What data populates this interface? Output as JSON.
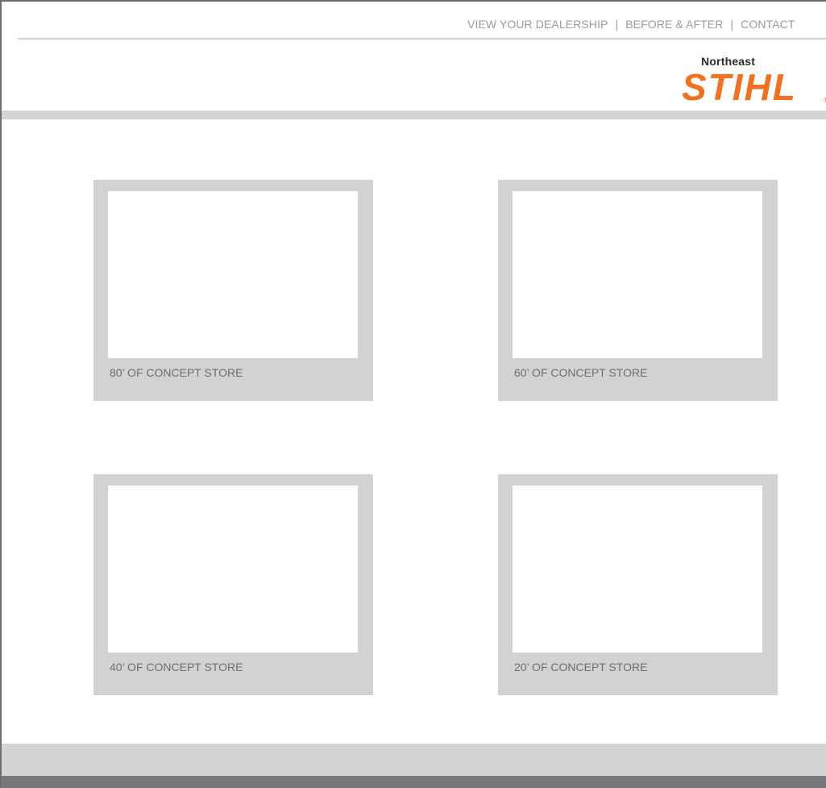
{
  "nav": {
    "items": [
      {
        "label": "VIEW YOUR DEALERSHIP"
      },
      {
        "label": "BEFORE & AFTER"
      },
      {
        "label": "CONTACT"
      }
    ],
    "separator": "|"
  },
  "logo": {
    "region": "Northeast",
    "brand": "STIHL",
    "brand_color": "#f37021",
    "registered_mark": "®"
  },
  "stores": [
    {
      "caption": "80’ OF CONCEPT STORE"
    },
    {
      "caption": "60’ OF CONCEPT STORE"
    },
    {
      "caption": "40’ OF CONCEPT STORE"
    },
    {
      "caption": "20’ OF CONCEPT STORE"
    }
  ],
  "colors": {
    "card_bg": "#d1d2d4",
    "caption_text": "#6d6e70",
    "nav_text": "#9a9b9d",
    "footer_bar": "#77787b"
  }
}
